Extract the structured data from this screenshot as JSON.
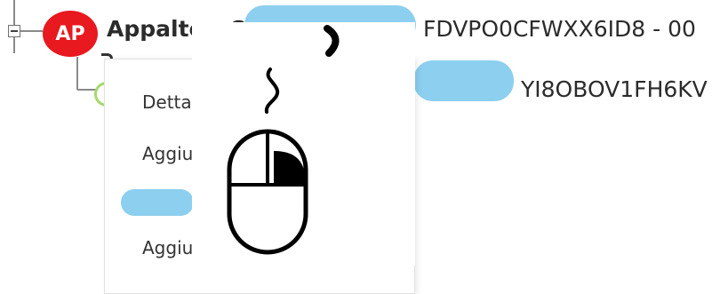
{
  "tree": {
    "root": {
      "badge": "AP",
      "title": "Appalto - C",
      "code": "FDVPO0CFWXX6ID8 - 00"
    },
    "child": {
      "code": "YI8OBOV1FH6KV"
    }
  },
  "context_menu": {
    "items": [
      "Dettaglio importi",
      "Aggiu",
      "Aggiu"
    ]
  },
  "colors": {
    "badge": "#e8191f",
    "redaction_pill": "#8ccfef",
    "text": "#2b2b2b"
  },
  "icons": {
    "cursor": "mouse-icon"
  }
}
